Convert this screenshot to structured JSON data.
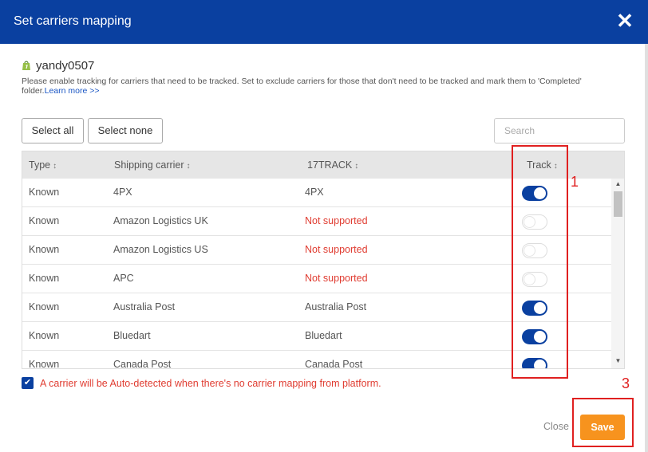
{
  "header": {
    "title": "Set carriers mapping",
    "close_glyph": "✕"
  },
  "store": {
    "icon": "shopify-bag-icon",
    "name": "yandy0507"
  },
  "description": {
    "text": "Please enable tracking for carriers that need to be tracked. Set to exclude carriers for those that don't need to be tracked and mark them to 'Completed' folder.",
    "link": "Learn more >>"
  },
  "toolbar": {
    "select_all": "Select all",
    "select_none": "Select none",
    "search_placeholder": "Search"
  },
  "table": {
    "columns": [
      "Type",
      "Shipping carrier",
      "17TRACK",
      "Track"
    ],
    "sort_glyph": "↕",
    "rows": [
      {
        "type": "Known",
        "carrier": "4PX",
        "track17": "4PX",
        "supported": true,
        "tracked": true
      },
      {
        "type": "Known",
        "carrier": "Amazon Logistics UK",
        "track17": "Not supported",
        "supported": false,
        "tracked": false
      },
      {
        "type": "Known",
        "carrier": "Amazon Logistics US",
        "track17": "Not supported",
        "supported": false,
        "tracked": false
      },
      {
        "type": "Known",
        "carrier": "APC",
        "track17": "Not supported",
        "supported": false,
        "tracked": false
      },
      {
        "type": "Known",
        "carrier": "Australia Post",
        "track17": "Australia Post",
        "supported": true,
        "tracked": true
      },
      {
        "type": "Known",
        "carrier": "Bluedart",
        "track17": "Bluedart",
        "supported": true,
        "tracked": true
      },
      {
        "type": "Known",
        "carrier": "Canada Post",
        "track17": "Canada Post",
        "supported": true,
        "tracked": true
      }
    ]
  },
  "auto_detect": {
    "checked": true,
    "label": "A carrier will be Auto-detected when there's no carrier mapping from platform."
  },
  "footer": {
    "close_label": "Close",
    "save_label": "Save"
  },
  "annotations": {
    "marker_1": "1",
    "marker_3": "3",
    "color": "#e02020"
  },
  "colors": {
    "header_bg": "#0a40a0",
    "save_bg": "#f7931e",
    "unsupported": "#e03c31",
    "toggle_on": "#0a40a0"
  }
}
